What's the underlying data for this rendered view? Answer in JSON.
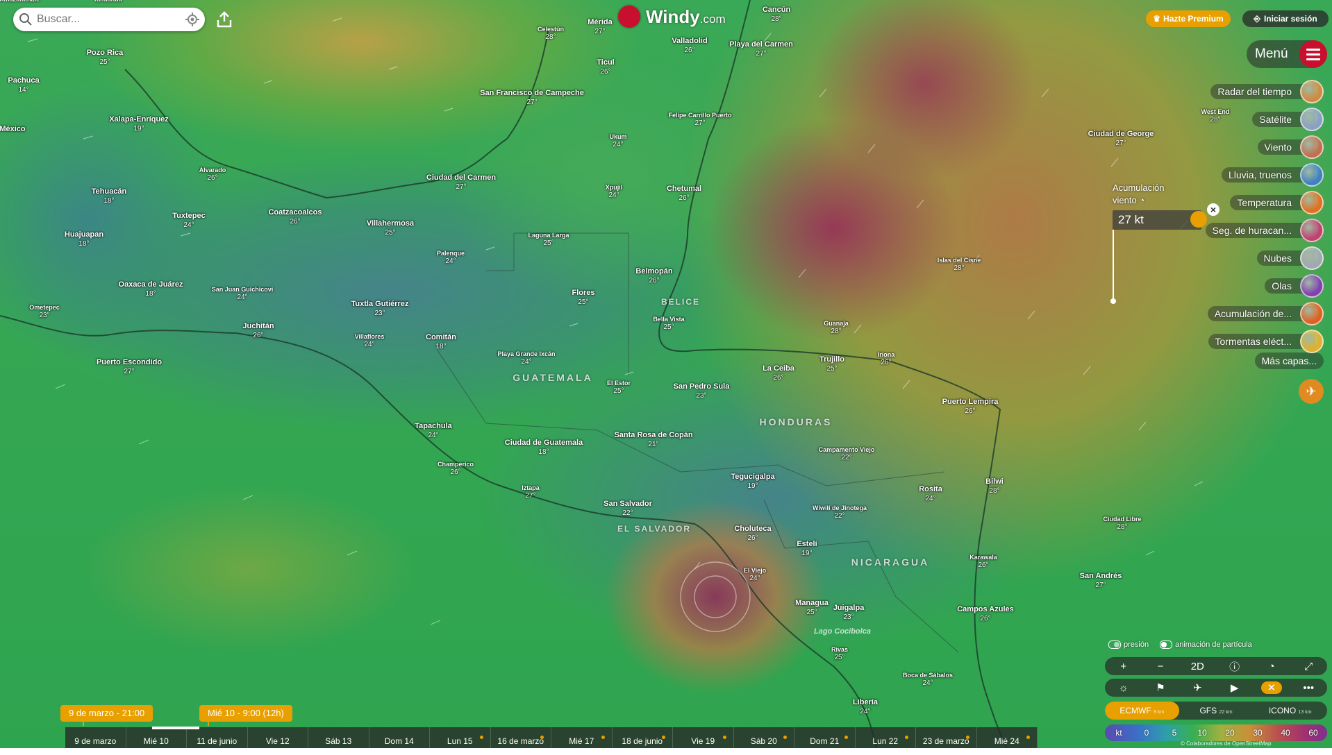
{
  "search": {
    "placeholder": "Buscar..."
  },
  "logo": {
    "name": "Windy",
    "tld": ".com"
  },
  "top_right": {
    "premium": "Hazte Premium",
    "login": "Iniciar sesión"
  },
  "menu": {
    "label": "Menú"
  },
  "layers": [
    {
      "label": "Radar del tiempo",
      "color": "#d08a40"
    },
    {
      "label": "Satélite",
      "color": "#8aa0c0"
    },
    {
      "label": "Viento",
      "color": "#c07050"
    },
    {
      "label": "Lluvia, truenos",
      "color": "#4080c0"
    },
    {
      "label": "Temperatura",
      "color": "#e07020"
    },
    {
      "label": "Seg. de huracan...",
      "color": "#c04070"
    },
    {
      "label": "Nubes",
      "color": "#a0a8b0"
    },
    {
      "label": "Olas",
      "color": "#8040b0"
    },
    {
      "label": "Acumulación de...",
      "color": "#e06020"
    },
    {
      "label": "Tormentas eléct...",
      "color": "#e0b030"
    }
  ],
  "more_layers": "Más capas...",
  "picker": {
    "title_1": "Acumulación",
    "title_2": "viento",
    "value": "27 kt"
  },
  "toggles": {
    "pressure": "presión",
    "particles": "animación de partícula"
  },
  "controls": {
    "zoom_in": "+",
    "zoom_out": "−",
    "mode": "2D"
  },
  "models": [
    {
      "name": "ECMWF",
      "res": "9 km"
    },
    {
      "name": "GFS",
      "res": "22 km"
    },
    {
      "name": "ICONO",
      "res": "13 km"
    }
  ],
  "legend": {
    "unit": "kt",
    "values": [
      "0",
      "5",
      "10",
      "20",
      "30",
      "40",
      "60"
    ]
  },
  "attribution": "© Colaboradores de OpenStreetMap",
  "timeline": {
    "current": "9 de marzo - 21:00",
    "hover": "Mié 10 - 9:00 (12h)",
    "days": [
      "9 de marzo",
      "Mié 10",
      "11 de junio",
      "Vie 12",
      "Sáb 13",
      "Dom 14",
      "Lun 15",
      "16 de marzo",
      "Mié 17",
      "18 de junio",
      "Vie 19",
      "Sáb 20",
      "Dom 21",
      "Lun 22",
      "23 de marzo",
      "Mié 24"
    ]
  },
  "countries": [
    "GUATEMALA",
    "HONDURAS",
    "NICARAGUA",
    "EL SALVADOR",
    "BELICE"
  ],
  "lake": "Lago Cocibolca",
  "cities": [
    {
      "name": "Amazunchale",
      "temp": ""
    },
    {
      "name": "Tamiahua",
      "temp": ""
    },
    {
      "name": "Pozo Rica",
      "temp": "25°"
    },
    {
      "name": "Pachuca",
      "temp": "14°"
    },
    {
      "name": "México",
      "temp": ""
    },
    {
      "name": "Xalapa-Enríquez",
      "temp": "19°"
    },
    {
      "name": "Alvarado",
      "temp": "26°"
    },
    {
      "name": "Tehuacán",
      "temp": "18°"
    },
    {
      "name": "Coatzacoalcos",
      "temp": "26°"
    },
    {
      "name": "Tuxtepec",
      "temp": "24°"
    },
    {
      "name": "Huajuapan",
      "temp": "18°"
    },
    {
      "name": "Oaxaca de Juárez",
      "temp": "18°"
    },
    {
      "name": "San Juan Guichicovi",
      "temp": "24°"
    },
    {
      "name": "Ometepec",
      "temp": "23°"
    },
    {
      "name": "Juchitán",
      "temp": "26°"
    },
    {
      "name": "Puerto Escondido",
      "temp": "27°"
    },
    {
      "name": "Villahermosa",
      "temp": "25°"
    },
    {
      "name": "Ciudad del Carmen",
      "temp": "27°"
    },
    {
      "name": "San Francisco de Campeche",
      "temp": "27°"
    },
    {
      "name": "Celestún",
      "temp": "28°"
    },
    {
      "name": "Mérida",
      "temp": "27°"
    },
    {
      "name": "Ticul",
      "temp": "26°"
    },
    {
      "name": "Valladolid",
      "temp": "26°"
    },
    {
      "name": "Cancún",
      "temp": "28°"
    },
    {
      "name": "Playa del Carmen",
      "temp": "27°"
    },
    {
      "name": "Felipe Carrillo Puerto",
      "temp": "27°"
    },
    {
      "name": "Ukum",
      "temp": "24°"
    },
    {
      "name": "Xpujil",
      "temp": "24°"
    },
    {
      "name": "Chetumal",
      "temp": "26°"
    },
    {
      "name": "Laguna Larga",
      "temp": "25°"
    },
    {
      "name": "Palenque",
      "temp": "24°"
    },
    {
      "name": "Tuxtla Gutiérrez",
      "temp": "23°"
    },
    {
      "name": "Flores",
      "temp": "25°"
    },
    {
      "name": "Belmopán",
      "temp": "26°"
    },
    {
      "name": "Bella Vista",
      "temp": "25°"
    },
    {
      "name": "Comitán",
      "temp": "18°"
    },
    {
      "name": "Villaflores",
      "temp": "24°"
    },
    {
      "name": "Playa Grande Ixcán",
      "temp": "24°"
    },
    {
      "name": "El Estor",
      "temp": "25°"
    },
    {
      "name": "San Pedro Sula",
      "temp": "23°"
    },
    {
      "name": "La Ceiba",
      "temp": "26°"
    },
    {
      "name": "Trujillo",
      "temp": "25°"
    },
    {
      "name": "Guanaja",
      "temp": "28°"
    },
    {
      "name": "Iriona",
      "temp": "26°"
    },
    {
      "name": "Islas del Cisne",
      "temp": "28°"
    },
    {
      "name": "Puerto Lempira",
      "temp": "26°"
    },
    {
      "name": "Tapachula",
      "temp": "24°"
    },
    {
      "name": "Ciudad de Guatemala",
      "temp": "18°"
    },
    {
      "name": "Santa Rosa de Copán",
      "temp": "21°"
    },
    {
      "name": "Champerico",
      "temp": "26°"
    },
    {
      "name": "Iztapa",
      "temp": "27°"
    },
    {
      "name": "San Salvador",
      "temp": "22°"
    },
    {
      "name": "Tegucigalpa",
      "temp": "19°"
    },
    {
      "name": "Campamento Viejo",
      "temp": "22°"
    },
    {
      "name": "Rosita",
      "temp": "24°"
    },
    {
      "name": "Bilwi",
      "temp": "28°"
    },
    {
      "name": "Wiwilí de Jinotega",
      "temp": "22°"
    },
    {
      "name": "Choluteca",
      "temp": "26°"
    },
    {
      "name": "Estelí",
      "temp": "19°"
    },
    {
      "name": "El Viejo",
      "temp": "24°"
    },
    {
      "name": "Karawala",
      "temp": "26°"
    },
    {
      "name": "Managua",
      "temp": "25°"
    },
    {
      "name": "Juigalpa",
      "temp": "23°"
    },
    {
      "name": "Campos Azules",
      "temp": "26°"
    },
    {
      "name": "Rivas",
      "temp": "25°"
    },
    {
      "name": "Boca de Sábalos",
      "temp": "24°"
    },
    {
      "name": "Liberia",
      "temp": "24°"
    },
    {
      "name": "Ciudad de George",
      "temp": "27°"
    },
    {
      "name": "West End",
      "temp": "28°"
    },
    {
      "name": "Ciudad Libre",
      "temp": "28°"
    },
    {
      "name": "San Andrés",
      "temp": "27°"
    }
  ]
}
